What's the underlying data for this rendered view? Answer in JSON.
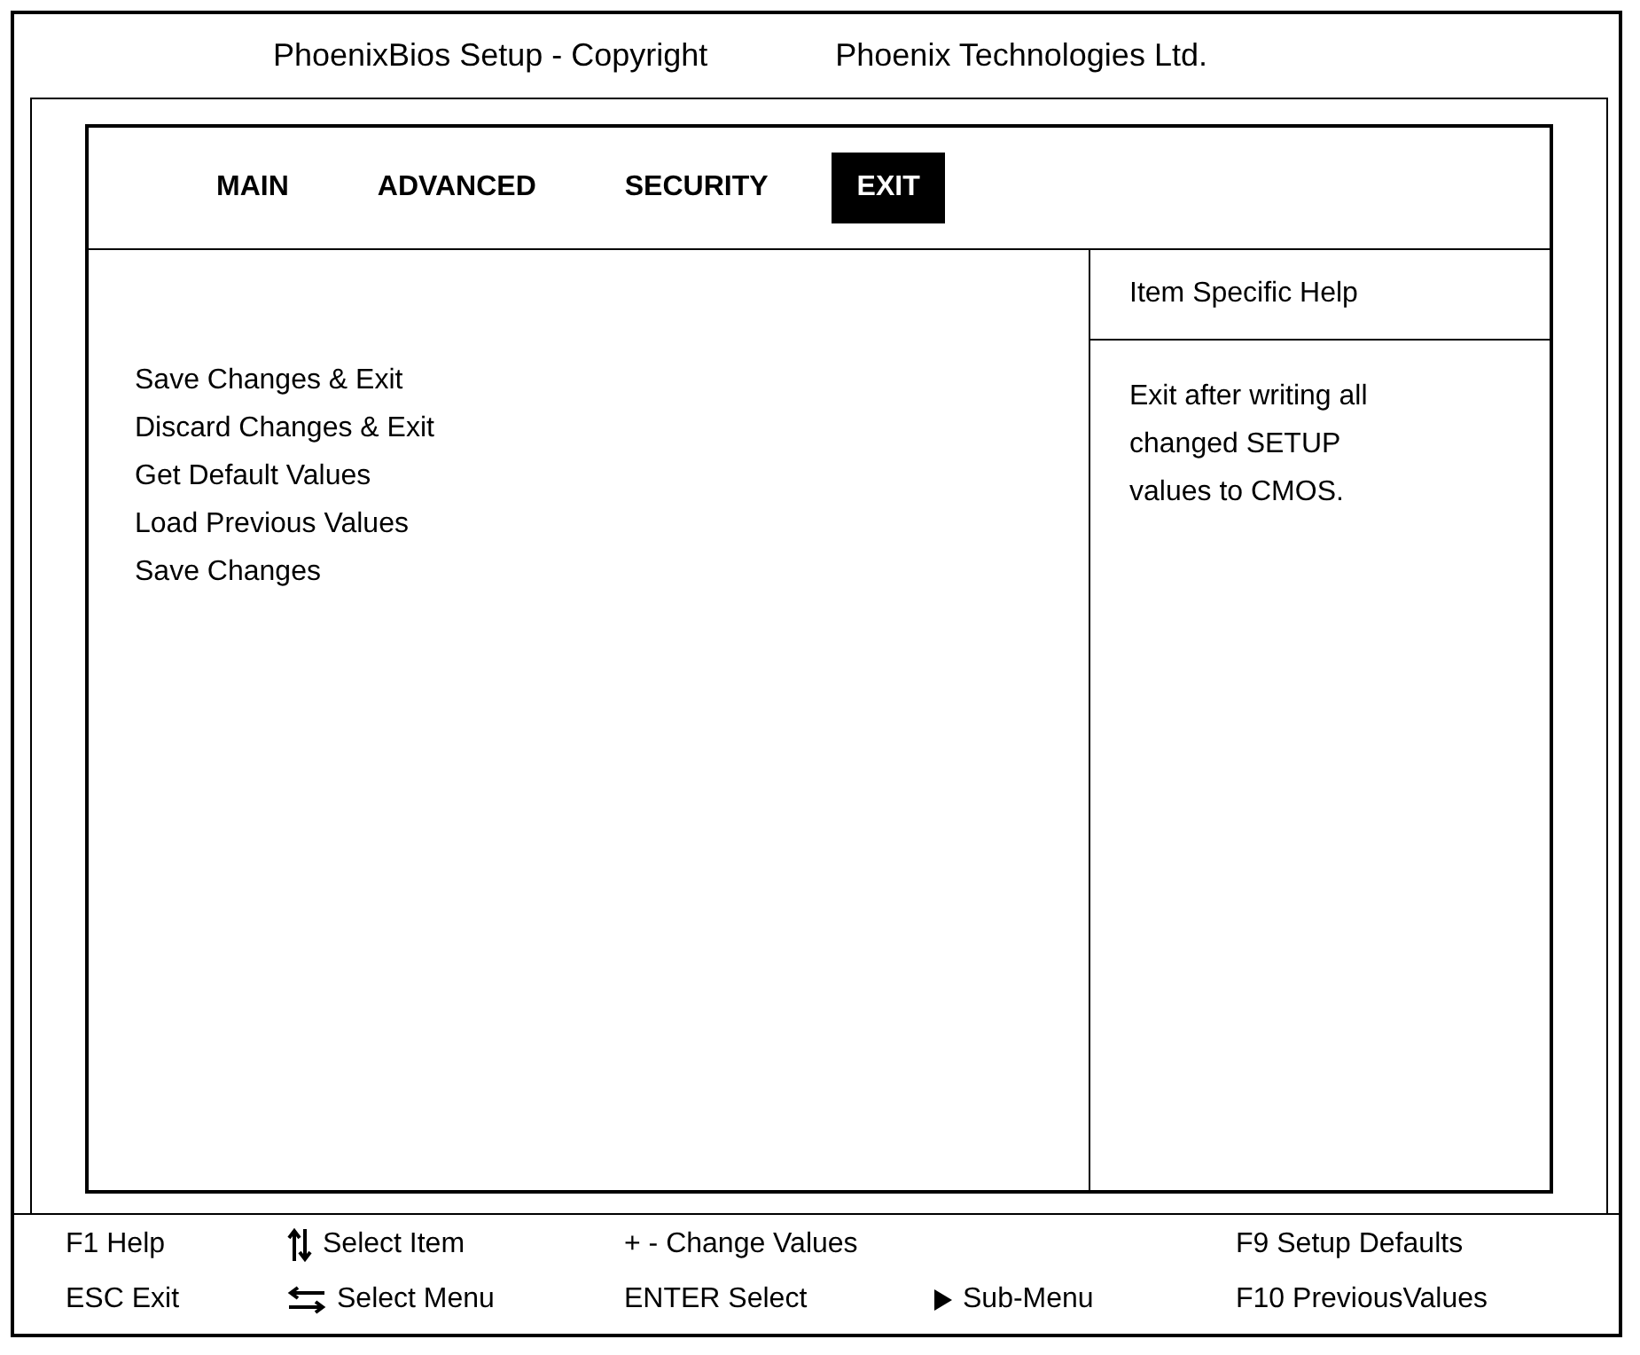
{
  "header": {
    "title": "PhoenixBios Setup - Copyright",
    "vendor": "Phoenix Technologies Ltd."
  },
  "tabs": [
    {
      "label": "MAIN",
      "selected": false
    },
    {
      "label": "ADVANCED",
      "selected": false
    },
    {
      "label": "SECURITY",
      "selected": false
    },
    {
      "label": "EXIT",
      "selected": true
    }
  ],
  "menu_items": [
    "Save Changes & Exit",
    "Discard Changes & Exit",
    "Get Default Values",
    "Load Previous Values",
    "Save Changes"
  ],
  "help": {
    "title": "Item Specific Help",
    "lines": [
      "Exit after writing all",
      "changed SETUP",
      "values to CMOS."
    ]
  },
  "footer": {
    "columns": [
      [
        {
          "text": "F1 Help"
        },
        {
          "text": "ESC Exit"
        }
      ],
      [
        {
          "kind": "updown",
          "text": "Select Item"
        },
        {
          "kind": "leftright",
          "text": "Select Menu"
        }
      ],
      [
        {
          "text": "+ - Change Values"
        },
        {
          "text": "ENTER Select"
        }
      ],
      [
        {
          "kind": "triangle",
          "text": "Sub-Menu"
        }
      ],
      [
        {
          "text": "F9 Setup Defaults"
        },
        {
          "text": "F10 PreviousValues"
        }
      ]
    ]
  }
}
